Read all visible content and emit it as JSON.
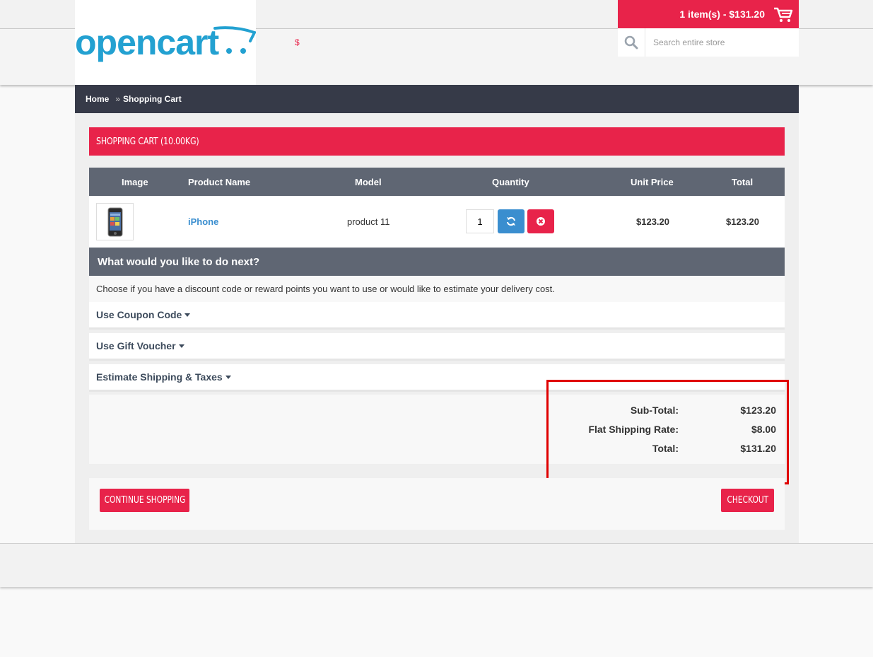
{
  "header": {
    "logo_text": "opencart",
    "currency_symbol": "$",
    "cart_summary": "1 item(s) - $131.20",
    "search_placeholder": "Search entire store"
  },
  "breadcrumb": {
    "items": [
      "Home",
      "Shopping Cart"
    ],
    "separator": "»"
  },
  "cart": {
    "heading": "SHOPPING CART  (10.00KG)",
    "columns": [
      "Image",
      "Product Name",
      "Model",
      "Quantity",
      "Unit Price",
      "Total"
    ],
    "rows": [
      {
        "image_icon": "iphone-thumbnail",
        "product_name": "iPhone",
        "model": "product 11",
        "quantity": "1",
        "unit_price": "$123.20",
        "total": "$123.20"
      }
    ]
  },
  "next_steps": {
    "heading": "What would you like to do next?",
    "description": "Choose if you have a discount code or reward points you want to use or would like to estimate your delivery cost.",
    "panels": [
      "Use Coupon Code",
      "Use Gift Voucher",
      "Estimate Shipping & Taxes"
    ]
  },
  "totals": [
    {
      "label": "Sub-Total:",
      "value": "$123.20"
    },
    {
      "label": "Flat Shipping Rate:",
      "value": "$8.00"
    },
    {
      "label": "Total:",
      "value": "$131.20"
    }
  ],
  "actions": {
    "continue_label": "CONTINUE SHOPPING",
    "checkout_label": "CHECKOUT"
  },
  "colors": {
    "accent": "#e8234a",
    "dark_bar": "#363a48",
    "table_header": "#5f6673",
    "link": "#3a8ecf",
    "logo": "#23a1d1",
    "highlight": "#e00000"
  }
}
